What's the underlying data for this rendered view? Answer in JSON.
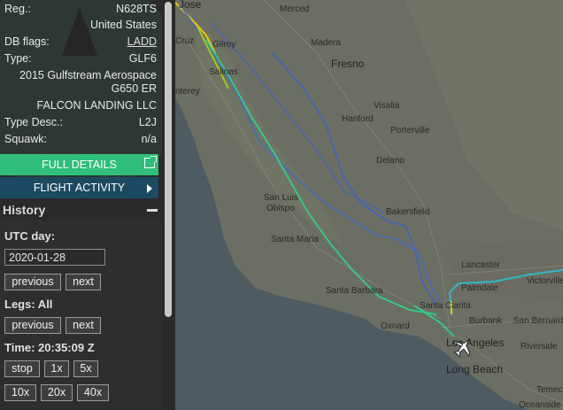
{
  "aircraft": {
    "reg_label": "Reg.:",
    "reg_value": "N628TS",
    "country": "United States",
    "dbflags_label": "DB flags:",
    "dbflags_value": "LADD",
    "type_label": "Type:",
    "type_value": "GLF6",
    "model_line1": "2015 Gulfstream Aerospace",
    "model_line2": "G650 ER",
    "owner": "FALCON LANDING LLC",
    "typedesc_label": "Type Desc.:",
    "typedesc_value": "L2J",
    "squawk_label": "Squawk:",
    "squawk_value": "n/a"
  },
  "buttons": {
    "full_details": "FULL DETAILS",
    "flight_activity": "FLIGHT ACTIVITY"
  },
  "history": {
    "title": "History",
    "utc_day_label": "UTC day:",
    "utc_day_value": "2020-01-28",
    "previous": "previous",
    "next": "next",
    "legs_label": "Legs: All",
    "legs_previous": "previous",
    "legs_next": "next",
    "time_label": "Time: 20:35:09 Z",
    "stop": "stop",
    "speed_1x": "1x",
    "speed_5x": "5x",
    "speed_10x": "10x",
    "speed_20x": "20x",
    "speed_40x": "40x"
  },
  "map": {
    "cities": {
      "jose": "Jose",
      "merced": "Merced",
      "cruz": "Cruz",
      "gilroy": "Gilroy",
      "madera": "Madera",
      "fresno": "Fresno",
      "salinas": "Salinas",
      "monterey": "nterey",
      "visalia": "Visalia",
      "hanford": "Hanford",
      "porterville": "Porterville",
      "delano": "Delano",
      "san_luis": "San Luis",
      "obispo": "Obispo",
      "bakersfield": "Bakersfield",
      "santa_maria": "Santa Maria",
      "lancaster": "Lancaster",
      "victorville": "Victorville",
      "palmdale": "Palmdale",
      "santa_barbara": "Santa Barbara",
      "santa_clarita": "Santa Clarita",
      "oxnard": "Oxnard",
      "burbank": "Burbank",
      "san_bernardino": "San Bernardino",
      "los_angeles": "Los Angeles",
      "riverside": "Riverside",
      "long_beach": "Long Beach",
      "temecula": "Temecula",
      "oceanside": "Oceanside"
    },
    "track_colors": [
      "#f5d000",
      "#9ad400",
      "#2fc66f",
      "#2fb8c8",
      "#3a6fd0"
    ]
  }
}
